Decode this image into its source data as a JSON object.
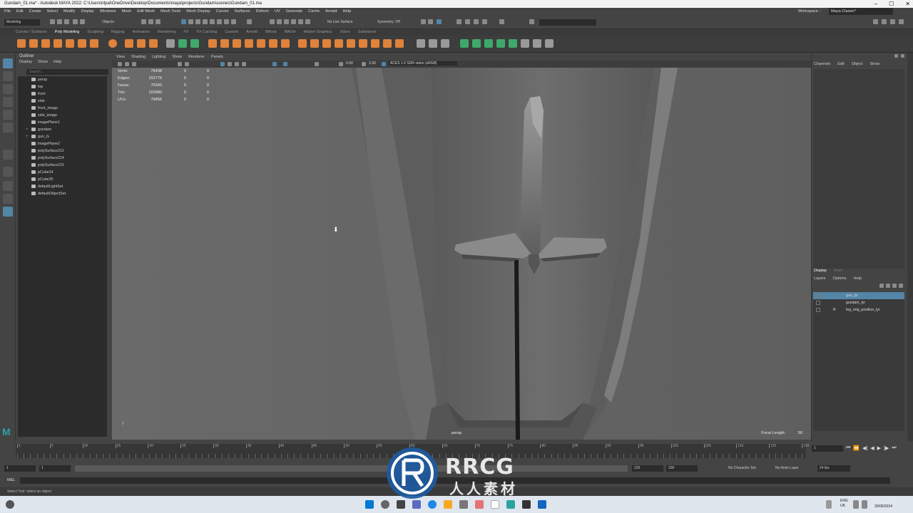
{
  "window": {
    "title": "Gundam_01.ma* - Autodesk MAYA 2022: C:\\Users\\ntpal\\OneDrive\\Desktop\\Documents\\maya\\projects\\Gundam\\scenes\\Gundam_01.ma"
  },
  "menubar": {
    "items": [
      "File",
      "Edit",
      "Create",
      "Select",
      "Modify",
      "Display",
      "Windows",
      "Mesh",
      "Edit Mesh",
      "Mesh Tools",
      "Mesh Display",
      "Curves",
      "Surfaces",
      "Deform",
      "UV",
      "Generate",
      "Cache",
      "Arnold",
      "Help"
    ],
    "workspace_label": "Workspace :",
    "workspace_value": "Maya Classic*"
  },
  "statusline": {
    "mode": "Modeling",
    "objects": "Objects",
    "symmetry": "Symmetry: Off",
    "live_surface": "No Live Surface"
  },
  "shelf": {
    "tabs": [
      "Curves / Surfaces",
      "Poly Modeling",
      "Sculpting",
      "Rigging",
      "Animation",
      "Rendering",
      "FX",
      "FX Caching",
      "Custom",
      "Arnold",
      "Bifrost",
      "MASH",
      "Motion Graphics",
      "XGen",
      "Substance"
    ],
    "active_tab": "Poly Modeling"
  },
  "outliner": {
    "title": "Outliner",
    "menus": [
      "Display",
      "Show",
      "Help"
    ],
    "search_placeholder": "Search...",
    "items": [
      {
        "label": "persp",
        "icon": "camera-icon",
        "expand": ""
      },
      {
        "label": "top",
        "icon": "camera-icon",
        "expand": ""
      },
      {
        "label": "front",
        "icon": "camera-icon",
        "expand": ""
      },
      {
        "label": "side",
        "icon": "camera-icon",
        "expand": ""
      },
      {
        "label": "front_image",
        "icon": "image-plane-icon",
        "expand": ""
      },
      {
        "label": "side_image",
        "icon": "image-plane-icon",
        "expand": ""
      },
      {
        "label": "imagePlane1",
        "icon": "image-plane-icon",
        "expand": ""
      },
      {
        "label": "gundam",
        "icon": "mesh-icon",
        "expand": "+"
      },
      {
        "label": "gun_G",
        "icon": "group-icon",
        "expand": "+"
      },
      {
        "label": "imagePlane2",
        "icon": "image-plane-icon",
        "expand": ""
      },
      {
        "label": "polySurface212",
        "icon": "mesh-icon",
        "expand": ""
      },
      {
        "label": "polySurface214",
        "icon": "mesh-icon",
        "expand": ""
      },
      {
        "label": "polySurface215",
        "icon": "mesh-icon",
        "expand": ""
      },
      {
        "label": "pCube24",
        "icon": "mesh-icon",
        "expand": ""
      },
      {
        "label": "pCube25",
        "icon": "mesh-icon",
        "expand": ""
      },
      {
        "label": "defaultLightSet",
        "icon": "set-icon",
        "expand": ""
      },
      {
        "label": "defaultObjectSet",
        "icon": "set-icon",
        "expand": ""
      }
    ]
  },
  "viewport": {
    "menus": [
      "View",
      "Shading",
      "Lighting",
      "Show",
      "Renderer",
      "Panels"
    ],
    "exposure": "0.00",
    "gamma": "1.00",
    "color_space": "ACES 1.0 SDR-video (sRGB)",
    "camera": "persp",
    "focal_label": "Focal Length:",
    "focal_value": "50",
    "hud": [
      {
        "label": "Verts:",
        "v1": "76438",
        "v2": "0",
        "v3": "0"
      },
      {
        "label": "Edges:",
        "v1": "152776",
        "v2": "0",
        "v3": "0"
      },
      {
        "label": "Faces:",
        "v1": "76340",
        "v2": "0",
        "v3": "0"
      },
      {
        "label": "Tris:",
        "v1": "152680",
        "v2": "0",
        "v3": "0"
      },
      {
        "label": "UVs:",
        "v1": "79456",
        "v2": "0",
        "v3": "0"
      }
    ]
  },
  "channelbox": {
    "menus": [
      "Channels",
      "Edit",
      "Object",
      "Show"
    ]
  },
  "layers": {
    "tabs": [
      "Display",
      "Anim"
    ],
    "menus": [
      "Layers",
      "Options",
      "Help"
    ],
    "rows": [
      {
        "name": "gun_lyr",
        "r": "",
        "selected": true
      },
      {
        "name": "gundam_lyr",
        "r": "",
        "selected": false
      },
      {
        "name": "leg_orig_position_lyr",
        "r": "R",
        "selected": false
      }
    ]
  },
  "timeline": {
    "ticks": [
      "1",
      "5",
      "10",
      "15",
      "20",
      "25",
      "30",
      "35",
      "40",
      "45",
      "50",
      "55",
      "60",
      "65",
      "70",
      "75",
      "80",
      "85",
      "90",
      "95",
      "100",
      "105",
      "110",
      "115",
      "120"
    ],
    "current_frame": "1",
    "range_start": "1",
    "range_start2": "1",
    "range_end": "120",
    "range_end2": "200",
    "character_set": "No Character Set",
    "anim_layer": "No Anim Layer",
    "fps": "24 fps"
  },
  "cmdline": {
    "label": "MEL"
  },
  "helpline": {
    "text": "Select Tool: select an object"
  },
  "taskbar": {
    "lang1": "ENG",
    "lang2": "UK",
    "date": "30/06/2024"
  },
  "watermark": {
    "brand": "RRCG",
    "sub": "人人素材"
  },
  "colors": {
    "accent": "#5285a6",
    "shelf_orange": "#e0823a",
    "shelf_green": "#3fa86b",
    "viewport_bg": "#656565"
  }
}
